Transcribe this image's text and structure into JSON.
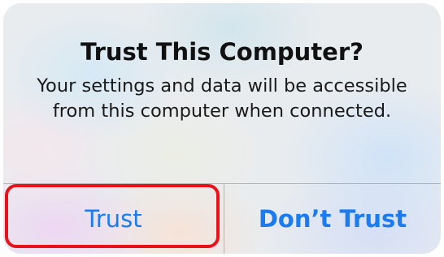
{
  "alert": {
    "title": "Trust This Computer?",
    "message": "Your settings and data will be accessible from this computer when connected.",
    "buttons": {
      "trust_label": "Trust",
      "dont_trust_label": "Don’t Trust"
    },
    "highlighted_button": "Trust",
    "colors": {
      "button_text": "#1a7cf0",
      "highlight_border": "#e8121b"
    }
  }
}
